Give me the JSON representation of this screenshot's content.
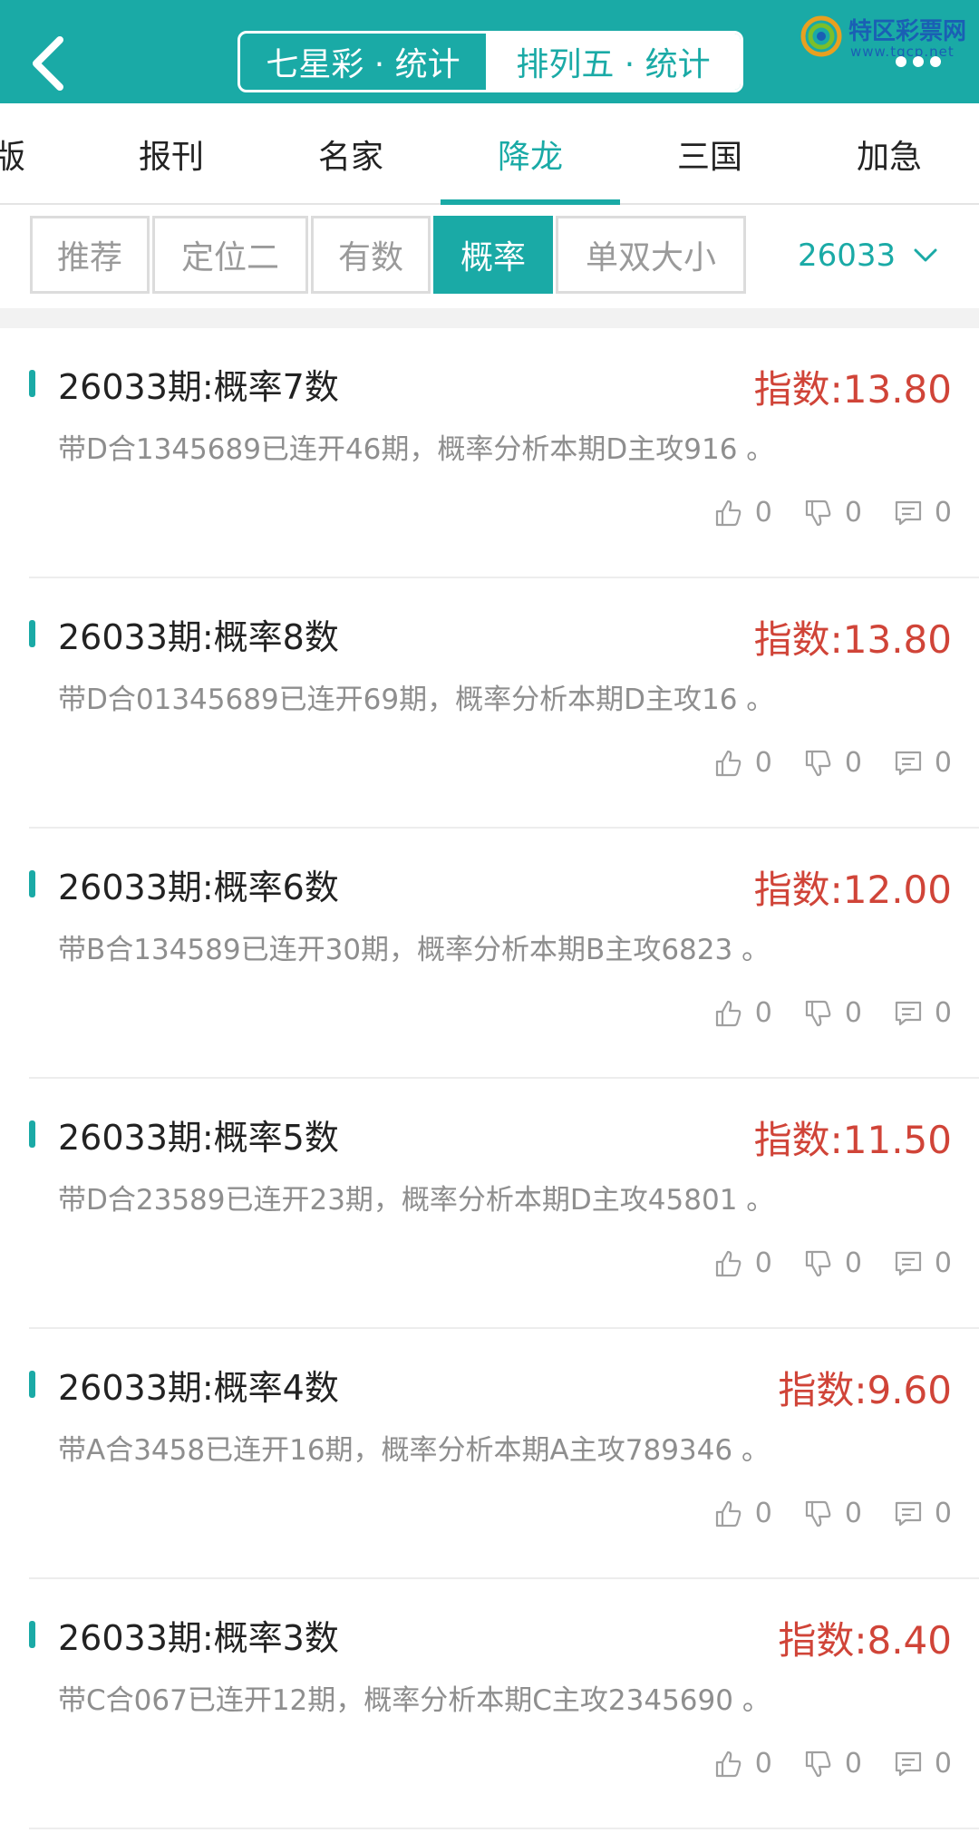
{
  "header": {
    "segments": [
      "七星彩 · 统计",
      "排列五 · 统计"
    ],
    "logo": {
      "title": "特区彩票网",
      "subtitle": "www.tqcp.net"
    }
  },
  "categories": [
    "版",
    "报刊",
    "名家",
    "降龙",
    "三国",
    "加急"
  ],
  "active_category": "降龙",
  "sub_tabs": [
    "推荐",
    "定位二",
    "有数",
    "概率",
    "单双大小"
  ],
  "active_sub_tab": "概率",
  "issue": "26033",
  "posts": [
    {
      "title": "26033期:概率7数",
      "index": "指数:13.80",
      "desc": "带D合1345689已连开46期，概率分析本期D主攻916 。",
      "likes": "0",
      "dislikes": "0",
      "comments": "0"
    },
    {
      "title": "26033期:概率8数",
      "index": "指数:13.80",
      "desc": "带D合01345689已连开69期，概率分析本期D主攻16 。",
      "likes": "0",
      "dislikes": "0",
      "comments": "0"
    },
    {
      "title": "26033期:概率6数",
      "index": "指数:12.00",
      "desc": "带B合134589已连开30期，概率分析本期B主攻6823 。",
      "likes": "0",
      "dislikes": "0",
      "comments": "0"
    },
    {
      "title": "26033期:概率5数",
      "index": "指数:11.50",
      "desc": "带D合23589已连开23期，概率分析本期D主攻45801 。",
      "likes": "0",
      "dislikes": "0",
      "comments": "0"
    },
    {
      "title": "26033期:概率4数",
      "index": "指数:9.60",
      "desc": "带A合3458已连开16期，概率分析本期A主攻789346 。",
      "likes": "0",
      "dislikes": "0",
      "comments": "0"
    },
    {
      "title": "26033期:概率3数",
      "index": "指数:8.40",
      "desc": "带C合067已连开12期，概率分析本期C主攻2345690 。",
      "likes": "0",
      "dislikes": "0",
      "comments": "0"
    }
  ],
  "colors": {
    "accent": "#1aaaa6",
    "index_red": "#d04438",
    "desc_gray": "#8e8e8e"
  }
}
